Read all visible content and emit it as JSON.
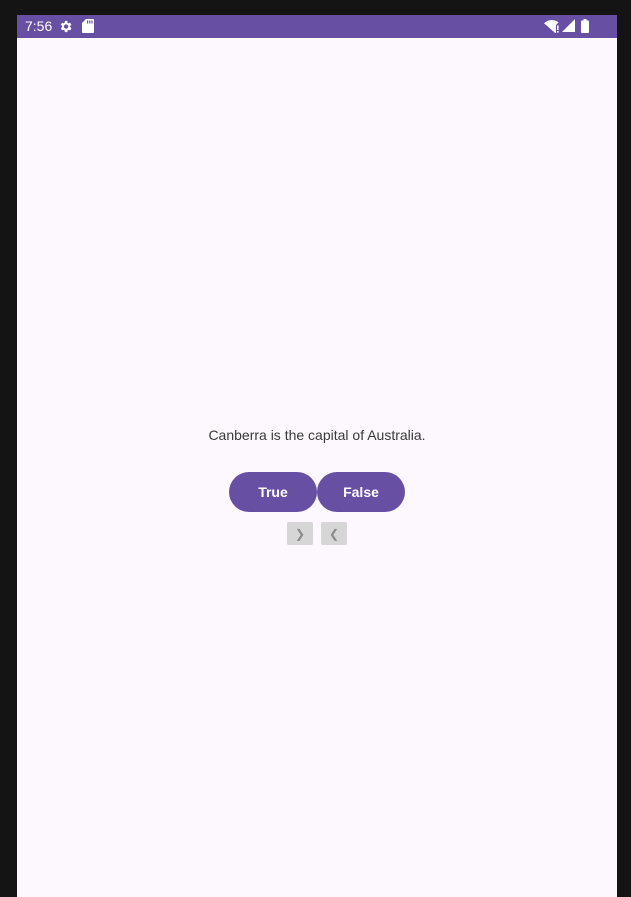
{
  "status_bar": {
    "time": "7:56",
    "color": "#6750a4",
    "icons": [
      "settings-gear-icon",
      "sd-card-icon",
      "wifi-icon",
      "cell-signal-icon",
      "battery-icon"
    ]
  },
  "quiz": {
    "question": "Canberra is the capital of Australia.",
    "true_label": "True",
    "false_label": "False",
    "next_glyph": "❯",
    "prev_glyph": "❮"
  },
  "colors": {
    "primary": "#6750a4",
    "background": "#fdf8fd",
    "nav_button": "#d6d6d6"
  }
}
